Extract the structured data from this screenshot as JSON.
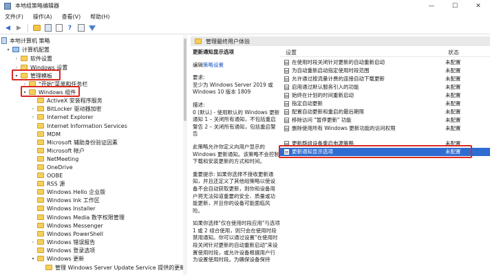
{
  "window": {
    "title": "本地组策略编辑器",
    "controls": {
      "minimize": "—",
      "maximize": "☐",
      "close": "✕"
    }
  },
  "menu": [
    "文件(F)",
    "操作(A)",
    "查看(V)",
    "帮助(H)"
  ],
  "toolbar": {
    "icons": [
      "back-icon",
      "forward-icon",
      "folder-icon",
      "pane-icon",
      "doc-icon",
      "help-icon",
      "list-icon",
      "filter-icon"
    ]
  },
  "tree": {
    "items": [
      {
        "label": "本地计算机 策略",
        "icon": "book-icon"
      },
      {
        "label": "计算机配置",
        "icon": "computer-icon"
      },
      {
        "label": "软件设置",
        "icon": "folder-icon"
      },
      {
        "label": "Windows 设置",
        "icon": "folder-icon"
      },
      {
        "label": "管理模板",
        "icon": "folder-icon"
      },
      {
        "label": "\"开始\"菜单和任务栏",
        "icon": "folder-icon"
      },
      {
        "label": "Windows 组件",
        "icon": "folder-icon"
      },
      {
        "label": "ActiveX 安装程序服务",
        "icon": "folder-icon"
      },
      {
        "label": "BitLocker 驱动器加密",
        "icon": "folder-icon"
      },
      {
        "label": "Internet Explorer",
        "icon": "folder-icon"
      },
      {
        "label": "Internet Information Services",
        "icon": "folder-icon"
      },
      {
        "label": "MDM",
        "icon": "folder-icon"
      },
      {
        "label": "Microsoft 辅助身份验证因素",
        "icon": "folder-icon"
      },
      {
        "label": "Microsoft 帐户",
        "icon": "folder-icon"
      },
      {
        "label": "NetMeeting",
        "icon": "folder-icon"
      },
      {
        "label": "OneDrive",
        "icon": "folder-icon"
      },
      {
        "label": "OOBE",
        "icon": "folder-icon"
      },
      {
        "label": "RSS 源",
        "icon": "folder-icon"
      },
      {
        "label": "Windows Hello 企业版",
        "icon": "folder-icon"
      },
      {
        "label": "Windows Ink 工作区",
        "icon": "folder-icon"
      },
      {
        "label": "Windows Installer",
        "icon": "folder-icon"
      },
      {
        "label": "Windows Media 数字权限管理",
        "icon": "folder-icon"
      },
      {
        "label": "Windows Messenger",
        "icon": "folder-icon"
      },
      {
        "label": "Windows PowerShell",
        "icon": "folder-icon"
      },
      {
        "label": "Windows 错误报告",
        "icon": "folder-icon"
      },
      {
        "label": "Windows 登录选项",
        "icon": "folder-icon"
      },
      {
        "label": "Windows 更新",
        "icon": "folder-icon"
      },
      {
        "label": "管理 Windows Server Update Service 提供的更新",
        "icon": "folder-icon"
      }
    ]
  },
  "content": {
    "header": "管理最终用户体验",
    "description": {
      "title": "更新通知显示选项",
      "edit_prefix": "编辑",
      "edit_link": "策略设置",
      "requirements_label": "要求:",
      "requirements": "至少为 Windows Server 2019 或 Windows 10 版本 1809",
      "desc_label": "描述:",
      "desc_text": "0 (默认) - 使用默认的 Windows 更新通知 1 – 关闭所有通知，不包括重启警告 2 – 关闭所有通知，包括重启警告",
      "para1": "此策略允许你定义向用户显示的 Windows 更新通知。该策略不会控制下载和安装更新的方式和时间。",
      "para2": "重要提示: 如果你选择不接收更新通知，并且还定义了其他组策略以使设备不会自动获取更新，则你和设备用户将无法知道重要的安全、质量或功能更新，并且你的设备可能面临风险。",
      "para3": "如果你选择\"仅在使用时段应用\"与选项 1 或 2 组合使用，则只会在使用时段禁用通知。你可以通过设置\"在使用时段关闭针对更新的自动重新启动\"来设置使用时段，或允许设备根据用户行为设置使用时段。为确保设备保持"
    },
    "list": {
      "col_setting": "设置",
      "col_state": "状态",
      "rows": [
        {
          "name": "在使用时段关闭针对更新的自动重新启动",
          "state": "未配置"
        },
        {
          "name": "为自动重新启动指定使用时段范围",
          "state": "未配置"
        },
        {
          "name": "允许通过按流量计费的连接自动下载更新",
          "state": "未配置"
        },
        {
          "name": "启用通过默认服务引入的功能",
          "state": "未配置"
        },
        {
          "name": "始终在计划的时间重新启动",
          "state": "未配置"
        },
        {
          "name": "指定自动更新",
          "state": "未配置"
        },
        {
          "name": "配置自动更新和重启的最后期限",
          "state": "未配置"
        },
        {
          "name": "移除访问 \"暂停更新\" 功能",
          "state": "未配置"
        },
        {
          "name": "删除使用所有 Windows 更新功能的访问权限",
          "state": "未配置"
        },
        {
          "name": "更新群组设备重启电源策略",
          "state": "未配置"
        },
        {
          "name": "更新通知显示选项",
          "state": "未配置"
        }
      ]
    }
  },
  "colors": {
    "selection": "#2f6cd1",
    "highlight": "#d8281f",
    "folder": "#f6cf5b"
  }
}
